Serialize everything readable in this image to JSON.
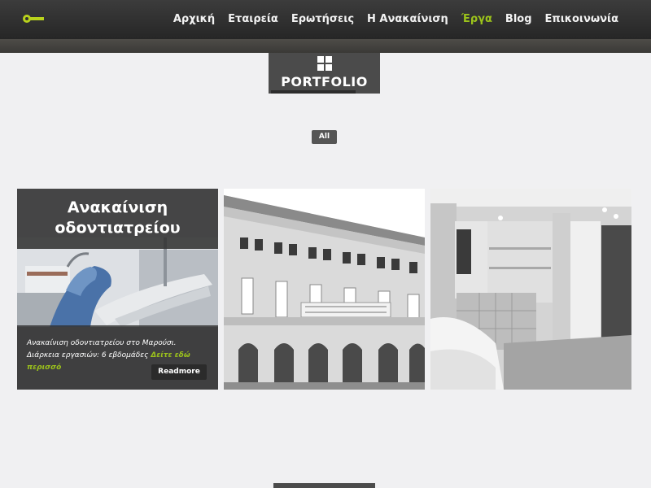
{
  "nav": {
    "logo": "logo-icon",
    "items": [
      {
        "label": "Αρχική",
        "active": false
      },
      {
        "label": "Εταιρεία",
        "active": false
      },
      {
        "label": "Ερωτήσεις",
        "active": false
      },
      {
        "label": "Η Ανακαίνιση",
        "active": false
      },
      {
        "label": "Έργα",
        "active": true
      },
      {
        "label": "Blog",
        "active": false
      },
      {
        "label": "Επικοινωνία",
        "active": false
      }
    ]
  },
  "portfolio": {
    "icon": "grid-icon",
    "title": "PORTFOLIO",
    "filter_all": "All"
  },
  "items": [
    {
      "title_line1": "Ανακαίνιση",
      "title_line2": "οδοντιατρείου",
      "description": "Ανακαίνιση οδοντιατρείου στο Μαρούσι. Διάρκεια εργασιών: 6 εβδομάδες ",
      "more": "Δείτε εδώ περισσό",
      "readmore": "Readmore",
      "image": "dental-chair-photo"
    },
    {
      "image": "neoclassical-building-photo"
    },
    {
      "image": "renovated-interior-photo"
    }
  ],
  "colors": {
    "accent": "#9cc31b",
    "nav_bg": "#2e2e2e",
    "badge_bg": "#4b4b4b",
    "page_bg": "#f0f0f2"
  }
}
